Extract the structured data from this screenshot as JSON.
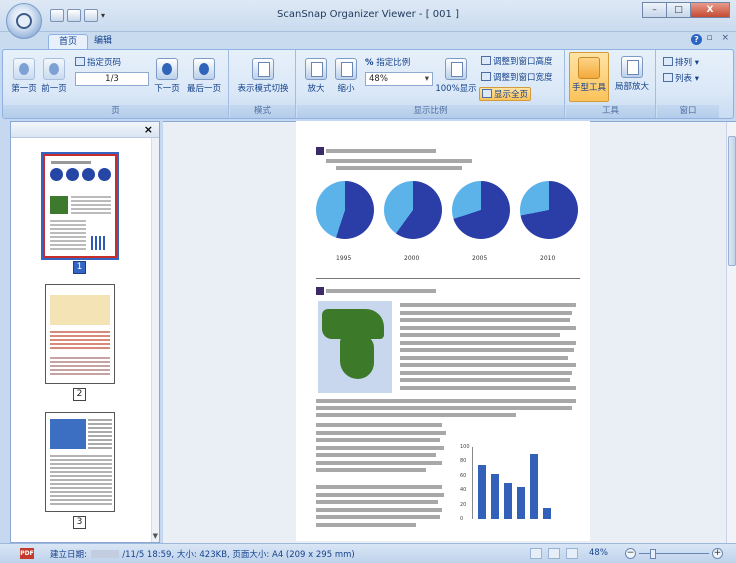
{
  "window": {
    "title": "ScanSnap Organizer Viewer - [ 001 ]",
    "minimize": "–",
    "maximize": "□",
    "close": "X"
  },
  "tabs": [
    {
      "label": "首页"
    },
    {
      "label": "编辑"
    }
  ],
  "tabbar": {
    "help": "?",
    "mini_controls": "– ▫ ×"
  },
  "ribbon": {
    "page_group": {
      "label": "页",
      "first": "第一页",
      "prev": "前一页",
      "specify_page": "指定页码",
      "page_value": "1/3",
      "next": "下一页",
      "last": "最后一页"
    },
    "mode_group": {
      "label": "模式",
      "switch": "表示模式切换"
    },
    "zoom_group": {
      "label": "显示比例",
      "zoom_in": "放大",
      "zoom_out": "缩小",
      "specify_ratio": "指定比例",
      "ratio_value": "48%",
      "hundred": "100%显示",
      "fit_height": "调整到窗口高度",
      "fit_width": "调整到窗口宽度",
      "show_all": "显示全页"
    },
    "tools_group": {
      "label": "工具",
      "hand": "手型工具",
      "partial_zoom": "局部放大"
    },
    "window_group": {
      "label": "窗口",
      "arrange": "排列",
      "list": "列表"
    }
  },
  "thumbnails": {
    "close": "×",
    "pages": [
      {
        "number": "1",
        "selected": true
      },
      {
        "number": "2",
        "selected": false
      },
      {
        "number": "3",
        "selected": false
      }
    ]
  },
  "document": {
    "pie_years": [
      "1995",
      "2000",
      "2005",
      "2010"
    ],
    "pie_shares": [
      0.55,
      0.6,
      0.7,
      0.72
    ],
    "bar_axis": [
      "100",
      "80",
      "60",
      "40",
      "20",
      "0"
    ],
    "bar_values": [
      75,
      62,
      50,
      45,
      90,
      15
    ]
  },
  "status": {
    "icon": "PDF",
    "created_label": "建立日期:",
    "created_rest": "/11/5 18:59, 大小: 423KB, 页面大小: A4 (209 x 295 mm)",
    "zoom": "48%",
    "zoom_fraction": 0.2
  }
}
